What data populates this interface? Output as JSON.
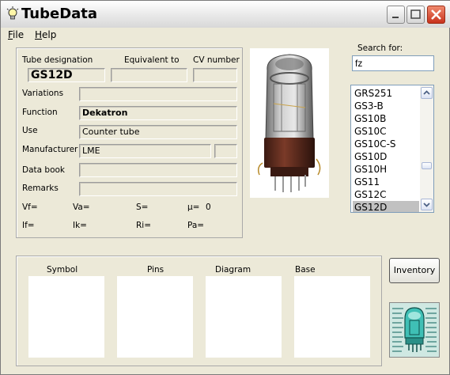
{
  "window": {
    "title": "TubeData"
  },
  "menu": {
    "file": "File",
    "help": "Help"
  },
  "tube": {
    "designation_label": "Tube designation",
    "equivalent_label": "Equivalent to",
    "cv_label": "CV number",
    "designation": "GS12D",
    "equivalent": "",
    "cv": "",
    "variations_label": "Variations",
    "variations": "",
    "function_label": "Function",
    "function": "Dekatron",
    "use_label": "Use",
    "use": "Counter tube",
    "manufacturer_label": "Manufacturer",
    "manufacturer": "LME",
    "manufacturer_extra": "",
    "databook_label": "Data book",
    "databook": "",
    "remarks_label": "Remarks",
    "remarks": ""
  },
  "params": {
    "vf": "Vf=",
    "va": "Va=",
    "s": "S=",
    "mu": "µ=",
    "mu_value": "0",
    "if": "If=",
    "ik": "Ik=",
    "ri": "Ri=",
    "pa": "Pa="
  },
  "search": {
    "label": "Search for:",
    "value": "fz"
  },
  "results": [
    "GRS251",
    "GS3-B",
    "GS10B",
    "GS10C",
    "GS10C-S",
    "GS10D",
    "GS10H",
    "GS11",
    "GS12C",
    "GS12D"
  ],
  "selected_result": "GS12D",
  "images": {
    "symbol": "Symbol",
    "pins": "Pins",
    "diagram": "Diagram",
    "base": "Base"
  },
  "inventory_button": "Inventory",
  "icons": {
    "app": "lightbulb-icon",
    "minimize": "minimize-icon",
    "maximize": "maximize-icon",
    "close": "close-icon"
  },
  "colors": {
    "close_button": "#c8321c",
    "selection": "#c1c1c1",
    "window_bg": "#ece9d8"
  }
}
